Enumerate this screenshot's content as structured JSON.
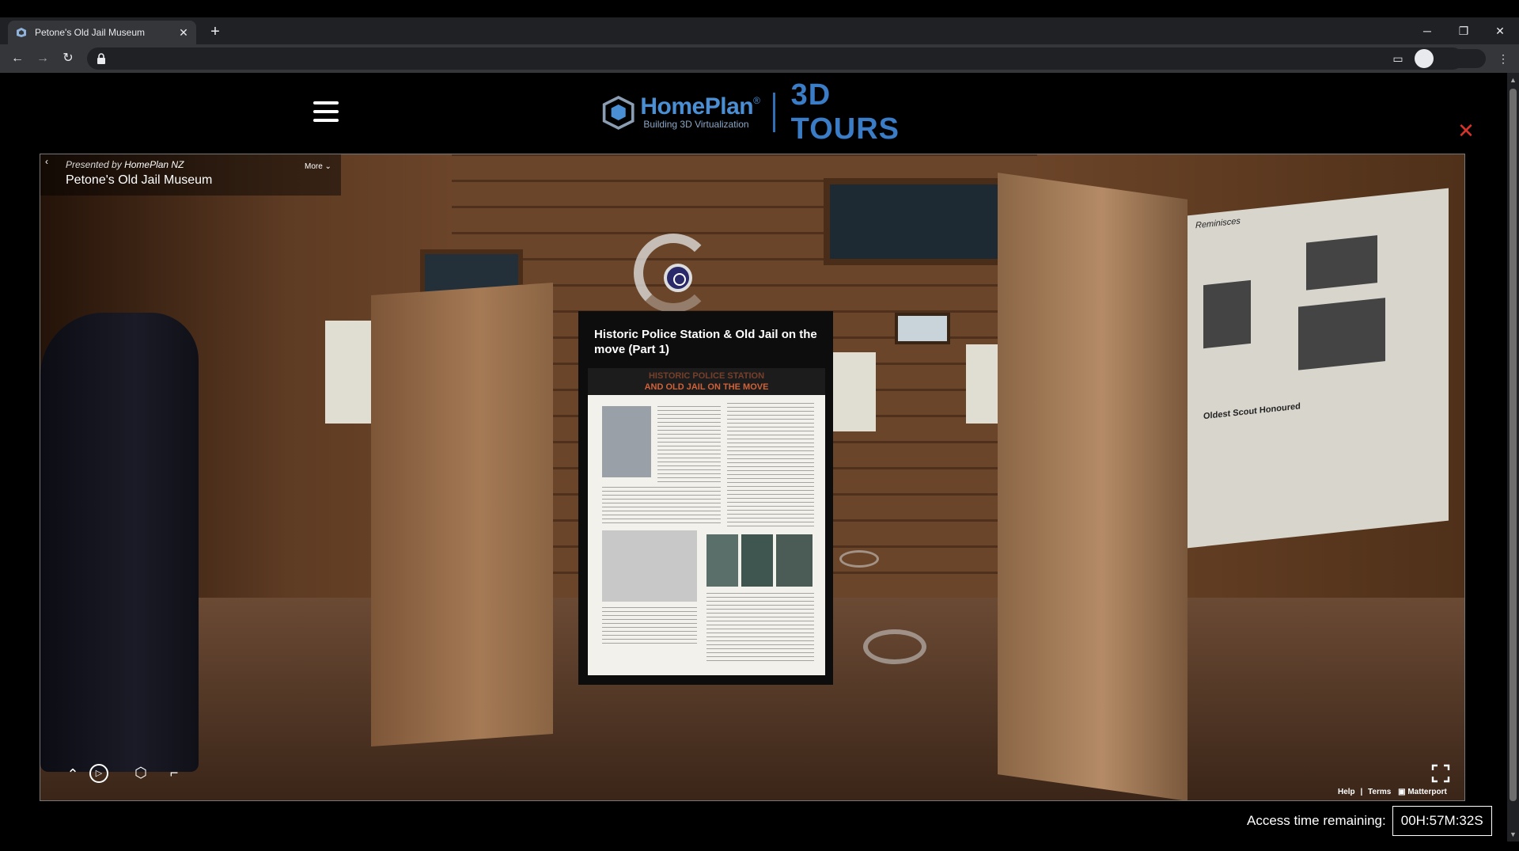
{
  "browser": {
    "tab_title": "Petone's Old Jail Museum",
    "tab_close": "✕",
    "new_tab": "+",
    "minimize": "─",
    "restore": "❐",
    "close": "✕",
    "back": "←",
    "forward": "→",
    "reload": "↻",
    "bookmark": "☆",
    "cast": "▭",
    "menu": "⋮"
  },
  "header": {
    "brand": "HomePlan",
    "brand_reg": "®",
    "tagline": "Building 3D Virtualization",
    "tours": "3D TOURS",
    "close_label": "✕",
    "accent_color": "#3a7cc6",
    "close_color": "#d9332b"
  },
  "viewer": {
    "back_label": "‹",
    "presented_prefix": "Presented by",
    "presenter": "HomePlan NZ",
    "title": "Petone's Old Jail Museum",
    "more_label": "More ⌄",
    "tag": {
      "title": "Historic Police Station & Old Jail on the move (Part 1)",
      "doc_heading_1": "HISTORIC POLICE STATION",
      "doc_heading_2": "AND OLD JAIL ON THE MOVE",
      "doc_section_1": "Reminisces",
      "doc_section_2": "Oldest Scout Honoured"
    },
    "controls": {
      "up": "⌃",
      "play": "▷",
      "dollhouse": "⬡",
      "floorplan": "⌐"
    },
    "footer": {
      "help": "Help",
      "sep": "|",
      "terms": "Terms",
      "matterport": "Matterport"
    }
  },
  "access": {
    "label": "Access time remaining:",
    "time": "00H:57M:32S"
  }
}
